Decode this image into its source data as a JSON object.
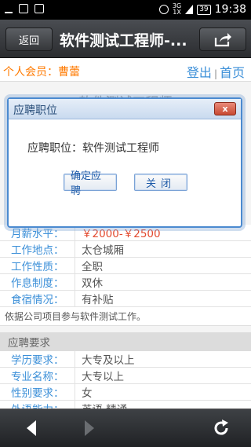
{
  "status": {
    "network": "3G",
    "network_sub": "1X",
    "battery": "39",
    "time": "19:38"
  },
  "header": {
    "back_label": "返回",
    "title": "软件测试工程师-...",
    "share_icon": "share-icon"
  },
  "member": {
    "label": "个人会员：",
    "name": "曹蕾",
    "logout": "登出",
    "separator": "|",
    "home": "首页"
  },
  "job_title_background": "软件测试工程师",
  "details": [
    {
      "key": "月薪水平：",
      "value": "￥2000-￥2500"
    },
    {
      "key": "工作地点：",
      "value": "太仓城厢"
    },
    {
      "key": "工作性质：",
      "value": "全职"
    },
    {
      "key": "作息制度：",
      "value": "双休"
    },
    {
      "key": "食宿情况：",
      "value": "有补贴"
    }
  ],
  "description": "依据公司项目参与软件测试工作。",
  "requirements": {
    "section_title": "应聘要求",
    "rows": [
      {
        "key": "学历要求：",
        "value": "大专及以上"
      },
      {
        "key": "专业名称：",
        "value": "大专以上"
      },
      {
        "key": "性别要求：",
        "value": "女"
      },
      {
        "key": "外语能力：",
        "value": "英语 精通"
      }
    ]
  },
  "dialog": {
    "title": "应聘职位",
    "close_label": "x",
    "message": "应聘职位：软件测试工程师",
    "ok_label": "确定应聘",
    "cancel_label": "关闭"
  },
  "colors": {
    "accent": "#3b8fd8",
    "member": "#ff7a00",
    "salary": "#e34a2f",
    "dialog_border": "#4b8ad0"
  }
}
